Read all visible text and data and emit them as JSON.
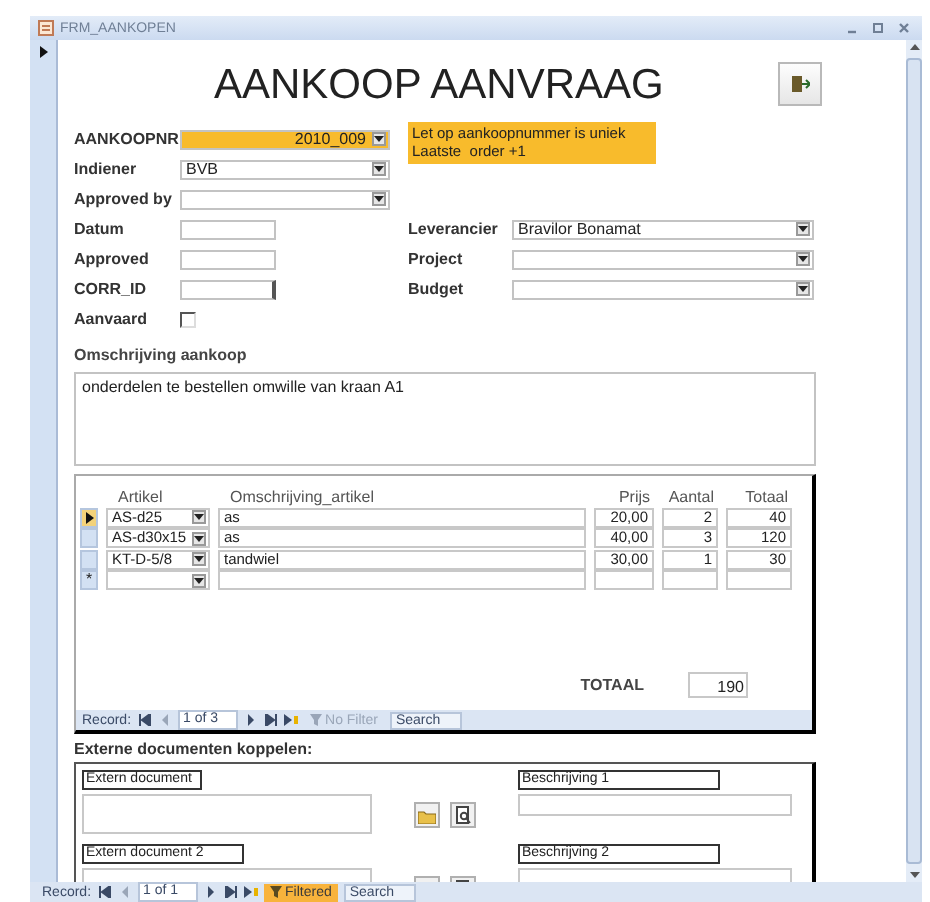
{
  "window": {
    "title": "FRM_AANKOPEN"
  },
  "form": {
    "heading": "AANKOOP AANVRAAG",
    "fields_left": [
      {
        "label": "AANKOOPNR",
        "kind": "number_combo",
        "value": "2010_009",
        "highlight": true
      },
      {
        "label": "Indiener",
        "kind": "combo",
        "value": "BVB",
        "highlight": false
      },
      {
        "label": "Approved by",
        "kind": "combo",
        "highlight": false
      },
      {
        "label": "Datum",
        "kind": "text",
        "focused": false
      },
      {
        "label": "Approved",
        "kind": "text",
        "focused": false
      },
      {
        "label": "CORR_ID",
        "kind": "text",
        "focused": true
      },
      {
        "label": "Aanvaard",
        "kind": "checkbox",
        "checked": false
      }
    ],
    "note": [
      "Let op aankoopnummer is uniek",
      "Laatste  order +1"
    ],
    "fields_right": [
      {
        "label": "Leverancier",
        "kind": "combo",
        "value": "Bravilor Bonamat"
      },
      {
        "label": "Project",
        "kind": "combo"
      },
      {
        "label": "Budget",
        "kind": "combo"
      }
    ],
    "description": {
      "label": "Omschrijving aankoop",
      "value": "onderdelen te bestellen omwille van kraan A1"
    }
  },
  "subform": {
    "columns": [
      "Artikel",
      "Omschrijving_artikel",
      "Prijs",
      "Aantal",
      "Totaal"
    ],
    "rows": [
      {
        "kind": "record",
        "selected": true,
        "cells": [
          "AS-d25",
          "as",
          "20,00",
          "2",
          "40"
        ]
      },
      {
        "kind": "record",
        "selected": false,
        "cells": [
          "AS-d30x15",
          "as",
          "40,00",
          "3",
          "120"
        ]
      },
      {
        "kind": "record",
        "selected": false,
        "cells": [
          "KT-D-5/8",
          "tandwiel",
          "30,00",
          "1",
          "30"
        ]
      },
      {
        "kind": "new",
        "selected": false,
        "marker": "*"
      }
    ],
    "total_label": "TOTAAL",
    "total": "190",
    "navigation": {
      "label": "Record:",
      "position": "1 of 3",
      "filter": "No Filter",
      "filtered": false,
      "placeholder": "Search"
    }
  },
  "attachments": {
    "title": "Externe documenten koppelen:",
    "items": [
      {
        "doc_label": "Extern document",
        "desc_label": "Beschrijving 1"
      },
      {
        "doc_label": "Extern document 2",
        "desc_label": "Beschrijving 2"
      }
    ]
  },
  "status_bar": {
    "label": "Record:",
    "position": "1 of 1",
    "filter": "Filtered",
    "filtered": true,
    "placeholder": "Search"
  }
}
